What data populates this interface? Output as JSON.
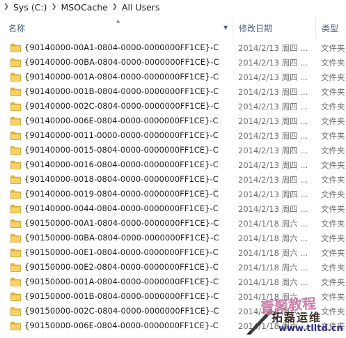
{
  "breadcrumb": {
    "parts": [
      "Sys (C:)",
      "MSOCache",
      "All Users"
    ]
  },
  "columns": {
    "name": "名称",
    "date": "修改日期",
    "type": "类型"
  },
  "rows": [
    {
      "name": "{90140000-00A1-0804-0000-0000000FF1CE}-C",
      "date": "2014/2/13 周四 ...",
      "type": "文件夹"
    },
    {
      "name": "{90140000-00BA-0804-0000-0000000FF1CE}-C",
      "date": "2014/2/13 周四 ...",
      "type": "文件夹"
    },
    {
      "name": "{90140000-001A-0804-0000-0000000FF1CE}-C",
      "date": "2014/2/13 周四 ...",
      "type": "文件夹"
    },
    {
      "name": "{90140000-001B-0804-0000-0000000FF1CE}-C",
      "date": "2014/2/13 周四 ...",
      "type": "文件夹"
    },
    {
      "name": "{90140000-002C-0804-0000-0000000FF1CE}-C",
      "date": "2014/2/13 周四 ...",
      "type": "文件夹"
    },
    {
      "name": "{90140000-006E-0804-0000-0000000FF1CE}-C",
      "date": "2014/2/13 周四 ...",
      "type": "文件夹"
    },
    {
      "name": "{90140000-0011-0000-0000-0000000FF1CE}-C",
      "date": "2014/2/13 周四 ...",
      "type": "文件夹"
    },
    {
      "name": "{90140000-0015-0804-0000-0000000FF1CE}-C",
      "date": "2014/2/13 周四 ...",
      "type": "文件夹"
    },
    {
      "name": "{90140000-0016-0804-0000-0000000FF1CE}-C",
      "date": "2014/2/13 周四 ...",
      "type": "文件夹"
    },
    {
      "name": "{90140000-0018-0804-0000-0000000FF1CE}-C",
      "date": "2014/2/13 周四 ...",
      "type": "文件夹"
    },
    {
      "name": "{90140000-0019-0804-0000-0000000FF1CE}-C",
      "date": "2014/2/13 周四 ...",
      "type": "文件夹"
    },
    {
      "name": "{90140000-0044-0804-0000-0000000FF1CE}-C",
      "date": "2014/2/13 周四 ...",
      "type": "文件夹"
    },
    {
      "name": "{90150000-00A1-0804-0000-0000000FF1CE}-C",
      "date": "2014/1/18 周六 ...",
      "type": "文件夹"
    },
    {
      "name": "{90150000-00BA-0804-0000-0000000FF1CE}-C",
      "date": "2014/1/18 周六 ...",
      "type": "文件夹"
    },
    {
      "name": "{90150000-00E1-0804-0000-0000000FF1CE}-C",
      "date": "2014/1/18 周六 ...",
      "type": "文件夹"
    },
    {
      "name": "{90150000-00E2-0804-0000-0000000FF1CE}-C",
      "date": "2014/1/18 周六 ...",
      "type": "文件夹"
    },
    {
      "name": "{90150000-001A-0804-0000-0000000FF1CE}-C",
      "date": "2014/1/18 周六 ...",
      "type": "文件夹"
    },
    {
      "name": "{90150000-001B-0804-0000-0000000FF1CE}-C",
      "date": "2014/1/18 周六 ...",
      "type": "文件夹"
    },
    {
      "name": "{90150000-002C-0804-0000-0000000FF1CE}-C",
      "date": "2014/1/18 周六 ...",
      "type": "文件夹"
    },
    {
      "name": "{90150000-006E-0804-0000-0000000FF1CE}-C",
      "date": "2014/1/18 周六 ...",
      "type": "文件夹"
    }
  ],
  "watermark": {
    "line1": "壹聚教程",
    "line2": "拓磊运维",
    "line3": "www.tlltd.cn"
  },
  "colors": {
    "header_text": "#4c607a",
    "folder_yellow": "#f5c544",
    "secondary_text": "#6d6d6d"
  },
  "icons": {
    "folder": "folder-icon",
    "breadcrumb_separator": "chevron-right-icon",
    "sort_indicator": "sort-up-icon",
    "column_dropdown": "chevron-down-icon"
  }
}
